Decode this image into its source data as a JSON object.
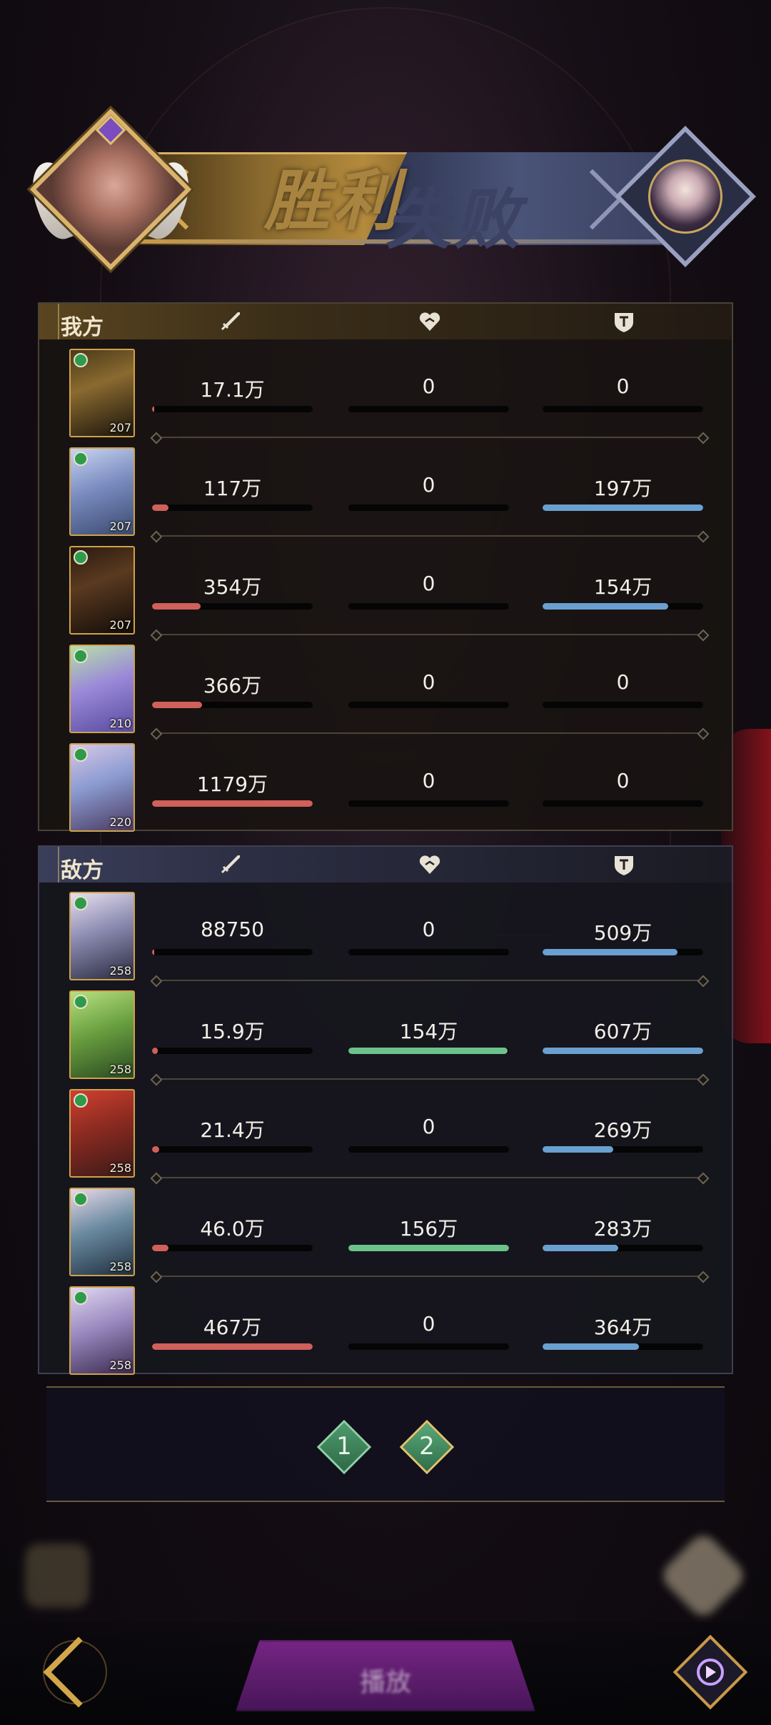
{
  "banner": {
    "victory_text": "胜利",
    "defeat_text": "失败"
  },
  "ours": {
    "title": "我方",
    "rows": [
      {
        "level": "207",
        "damage": "17.1万",
        "dmg_frac": 0.015,
        "heal": "0",
        "heal_frac": 0,
        "defense": "0",
        "def_frac": 0
      },
      {
        "level": "207",
        "damage": "117万",
        "dmg_frac": 0.1,
        "heal": "0",
        "heal_frac": 0,
        "defense": "197万",
        "def_frac": 1.0
      },
      {
        "level": "207",
        "damage": "354万",
        "dmg_frac": 0.3,
        "heal": "0",
        "heal_frac": 0,
        "defense": "154万",
        "def_frac": 0.78
      },
      {
        "level": "210",
        "damage": "366万",
        "dmg_frac": 0.31,
        "heal": "0",
        "heal_frac": 0,
        "defense": "0",
        "def_frac": 0
      },
      {
        "level": "220",
        "damage": "1179万",
        "dmg_frac": 1.0,
        "heal": "0",
        "heal_frac": 0,
        "defense": "0",
        "def_frac": 0
      }
    ]
  },
  "theirs": {
    "title": "敌方",
    "rows": [
      {
        "level": "258",
        "damage": "88750",
        "dmg_frac": 0.015,
        "heal": "0",
        "heal_frac": 0,
        "defense": "509万",
        "def_frac": 0.84
      },
      {
        "level": "258",
        "damage": "15.9万",
        "dmg_frac": 0.035,
        "heal": "154万",
        "heal_frac": 0.99,
        "defense": "607万",
        "def_frac": 1.0
      },
      {
        "level": "258",
        "damage": "21.4万",
        "dmg_frac": 0.046,
        "heal": "0",
        "heal_frac": 0,
        "defense": "269万",
        "def_frac": 0.44
      },
      {
        "level": "258",
        "damage": "46.0万",
        "dmg_frac": 0.1,
        "heal": "156万",
        "heal_frac": 1.0,
        "defense": "283万",
        "def_frac": 0.47
      },
      {
        "level": "258",
        "damage": "467万",
        "dmg_frac": 1.0,
        "heal": "0",
        "heal_frac": 0,
        "defense": "364万",
        "def_frac": 0.6
      }
    ]
  },
  "pager": {
    "pages": [
      "1",
      "2"
    ],
    "active": "2"
  },
  "bottom": {
    "replay_label": "播放"
  },
  "colors": {
    "damage": "#d0605a",
    "heal": "#6cc28a",
    "defense": "#6aa0d0",
    "gold": "#d2a74f"
  },
  "icons": {
    "damage": "sword-icon",
    "heal": "heart-icon",
    "defense": "shield-icon",
    "back": "back-arrow-icon",
    "video": "play-circle-icon"
  }
}
